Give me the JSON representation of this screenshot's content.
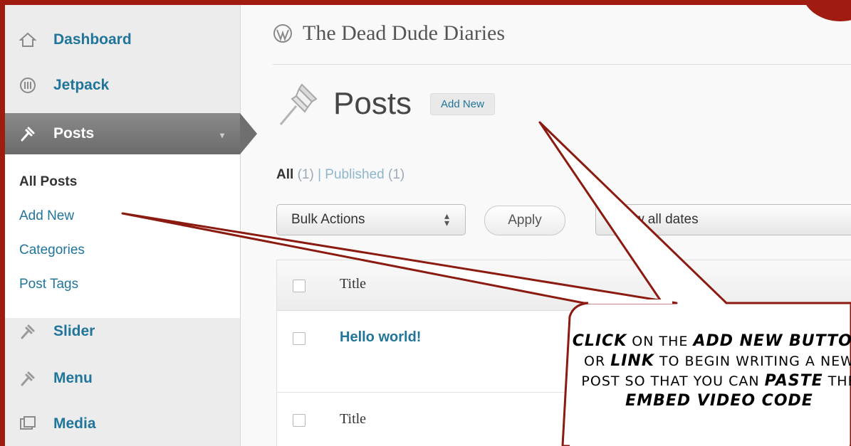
{
  "sidebar": {
    "items": [
      {
        "label": "Dashboard",
        "icon": "dashboard-icon"
      },
      {
        "label": "Jetpack",
        "icon": "jetpack-icon"
      },
      {
        "label": "Posts",
        "icon": "pin-icon"
      },
      {
        "label": "Slider",
        "icon": "pin-icon"
      },
      {
        "label": "Menu",
        "icon": "pin-icon"
      },
      {
        "label": "Media",
        "icon": "media-icon"
      }
    ],
    "submenu": [
      "All Posts",
      "Add New",
      "Categories",
      "Post Tags"
    ]
  },
  "header": {
    "site_title": "The Dead Dude Diaries"
  },
  "page": {
    "title": "Posts",
    "add_new_label": "Add New",
    "filters": {
      "all": "All",
      "all_count": "(1)",
      "separator": "|",
      "published": "Published",
      "published_count": "(1)"
    },
    "bulk_actions": "Bulk Actions",
    "apply_label": "Apply",
    "dates_filter": "Show all dates"
  },
  "table": {
    "header_title": "Title",
    "rows": [
      {
        "title": "Hello world!"
      }
    ],
    "footer_title": "Title"
  },
  "callout": {
    "parts": [
      {
        "text": "Click",
        "emph": true
      },
      {
        "text": " on the ",
        "emph": false
      },
      {
        "text": "Add New",
        "emph": true
      },
      {
        "text": " button",
        "emph": true
      },
      {
        "text": " or ",
        "emph": false
      },
      {
        "text": "link",
        "emph": true
      },
      {
        "text": " to begin writing a new post so that you can ",
        "emph": false
      },
      {
        "text": "paste",
        "emph": true
      },
      {
        "text": " the ",
        "emph": false
      },
      {
        "text": "embed video code",
        "emph": true
      }
    ]
  },
  "colors": {
    "frame": "#a01c10",
    "link": "#21759b",
    "sidebar_bg": "#ececec",
    "active_menu": "#6f6f6f"
  }
}
